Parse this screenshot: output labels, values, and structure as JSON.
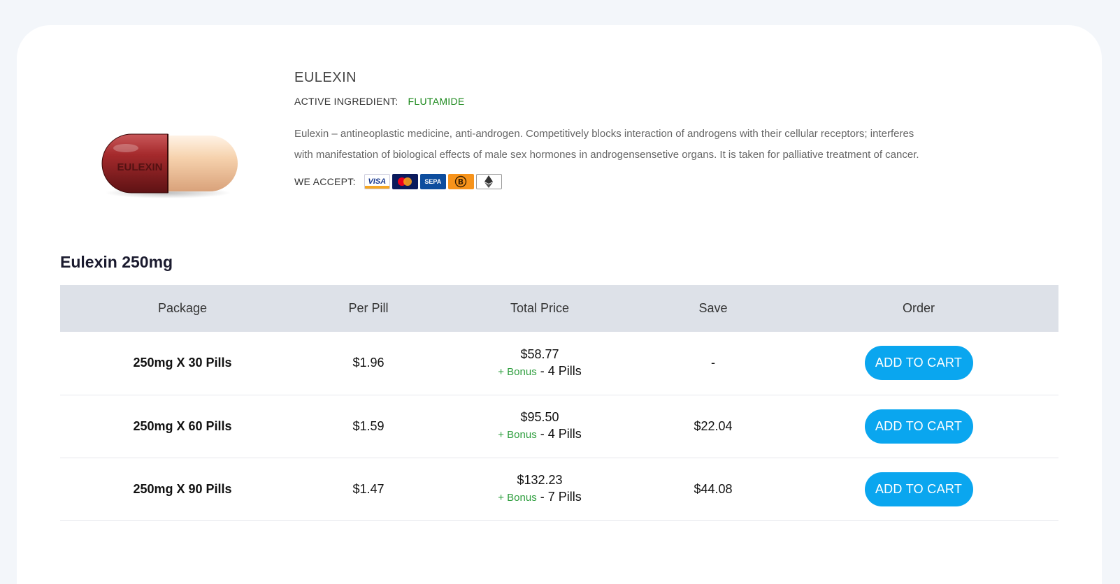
{
  "product": {
    "name": "EULEXIN",
    "capsule_text": "EULEXIN",
    "ingredient_label": "ACTIVE INGREDIENT:",
    "ingredient_value": "FLUTAMIDE",
    "description": "Eulexin – antineoplastic medicine, anti-androgen. Competitively blocks interaction of androgens with their cellular receptors; interferes with manifestation of biological effects of male sex hormones in androgensensetive organs. It is taken for palliative treatment of cancer.",
    "accept_label": "WE ACCEPT:",
    "payments": [
      {
        "icon": "visa-icon",
        "text": "VISA"
      },
      {
        "icon": "mastercard-icon",
        "text": "mastercard"
      },
      {
        "icon": "sepa-icon",
        "text": "SEPA"
      },
      {
        "icon": "bitcoin-icon",
        "text": "₿"
      },
      {
        "icon": "ethereum-icon",
        "text": "◆"
      }
    ]
  },
  "section": {
    "title": "Eulexin 250mg"
  },
  "table": {
    "headers": [
      "Package",
      "Per Pill",
      "Total Price",
      "Save",
      "Order"
    ],
    "rows": [
      {
        "package": "250mg X 30 Pills",
        "per_pill": "$1.96",
        "total": "$58.77",
        "bonus_label": "+ Bonus",
        "bonus_value": " - 4 Pills",
        "save": "-",
        "button": "ADD TO CART"
      },
      {
        "package": "250mg X 60 Pills",
        "per_pill": "$1.59",
        "total": "$95.50",
        "bonus_label": "+ Bonus",
        "bonus_value": " - 4 Pills",
        "save": "$22.04",
        "button": "ADD TO CART"
      },
      {
        "package": "250mg X 90 Pills",
        "per_pill": "$1.47",
        "total": "$132.23",
        "bonus_label": "+ Bonus",
        "bonus_value": " - 7 Pills",
        "save": "$44.08",
        "button": "ADD TO CART"
      }
    ]
  },
  "colors": {
    "accent": "#0aa6ef",
    "ingredient": "#1e8a1e",
    "bonus": "#2e9e3e",
    "save": "#d94040",
    "header_bg": "#dde1e8"
  }
}
